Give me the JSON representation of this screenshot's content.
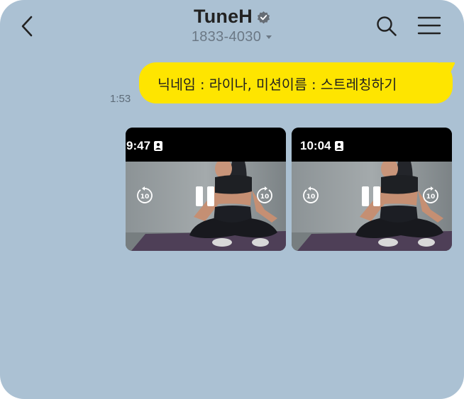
{
  "header": {
    "title": "TuneH",
    "subtitle": "1833-4030",
    "back_icon": "chevron-left-icon",
    "verified_icon": "verified-badge-icon",
    "search_icon": "search-icon",
    "menu_icon": "hamburger-menu-icon"
  },
  "chat": {
    "message": {
      "text": "닉네임 : 라이나, 미션이름 :  스트레칭하기",
      "time": "1:53"
    },
    "videos": [
      {
        "clock": "9:47",
        "rewind_label": "10",
        "forward_label": "10"
      },
      {
        "clock": "10:04",
        "rewind_label": "10",
        "forward_label": "10"
      }
    ]
  },
  "colors": {
    "background": "#abc1d3",
    "bubble": "#fee500"
  }
}
